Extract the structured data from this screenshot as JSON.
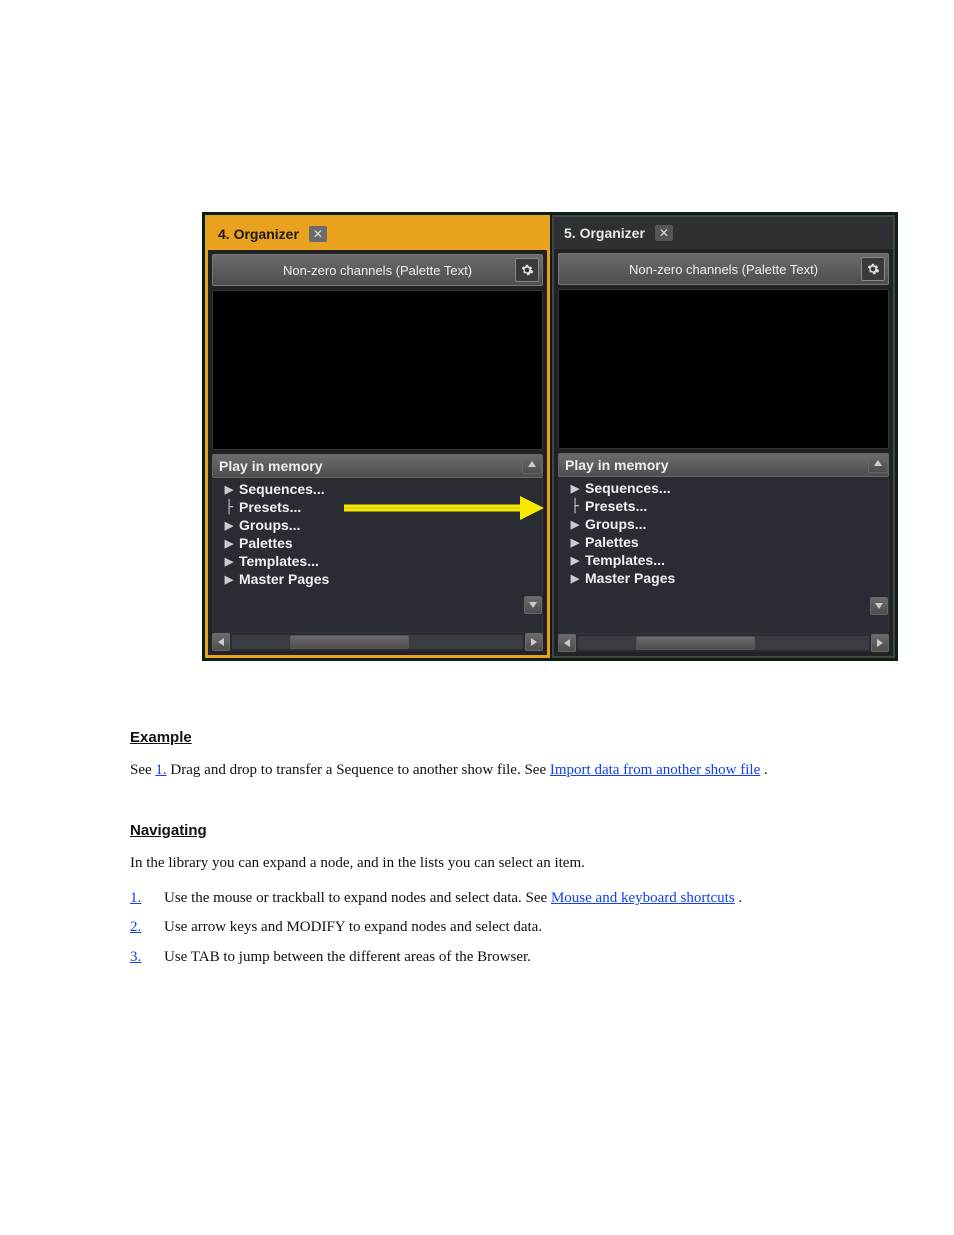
{
  "panels": [
    {
      "tab_title": "4. Organizer",
      "header": "Non-zero channels (Palette Text)",
      "section": "Play in memory",
      "items": [
        {
          "glyph": "tri",
          "label": "Sequences..."
        },
        {
          "glyph": "branch",
          "label": "Presets..."
        },
        {
          "glyph": "tri",
          "label": "Groups..."
        },
        {
          "glyph": "tri",
          "label": "Palettes"
        },
        {
          "glyph": "tri",
          "label": "Templates..."
        },
        {
          "glyph": "tri",
          "label": "Master Pages"
        }
      ]
    },
    {
      "tab_title": "5. Organizer",
      "header": "Non-zero channels (Palette Text)",
      "section": "Play in memory",
      "items": [
        {
          "glyph": "tri",
          "label": "Sequences..."
        },
        {
          "glyph": "branch",
          "label": "Presets..."
        },
        {
          "glyph": "tri",
          "label": "Groups..."
        },
        {
          "glyph": "tri",
          "label": "Palettes"
        },
        {
          "glyph": "tri",
          "label": "Templates..."
        },
        {
          "glyph": "tri",
          "label": "Master Pages"
        }
      ]
    }
  ],
  "doc": {
    "h1": "Example",
    "p1_a": "See ",
    "p1_link1_num": "1.",
    "p1_link1_txt": "",
    "p1_b": " Drag and drop to transfer a Sequence to another show file. See ",
    "p1_link2": "Import data from another show file",
    "p1_c": ".",
    "h2": "Navigating",
    "p2": "In the library you can expand a node, and in the lists you can select an item.",
    "b1_num": "1.",
    "b1_txt": " Use the mouse or trackball to expand nodes and select data. See ",
    "b1_link": "Mouse and keyboard shortcuts",
    "b1_end": ".",
    "b2_num": "2.",
    "b2_txt": " Use arrow keys and MODIFY to expand nodes and select data.",
    "b3_num": "3.",
    "b3_txt": " Use TAB to jump between the different areas of the Browser."
  }
}
